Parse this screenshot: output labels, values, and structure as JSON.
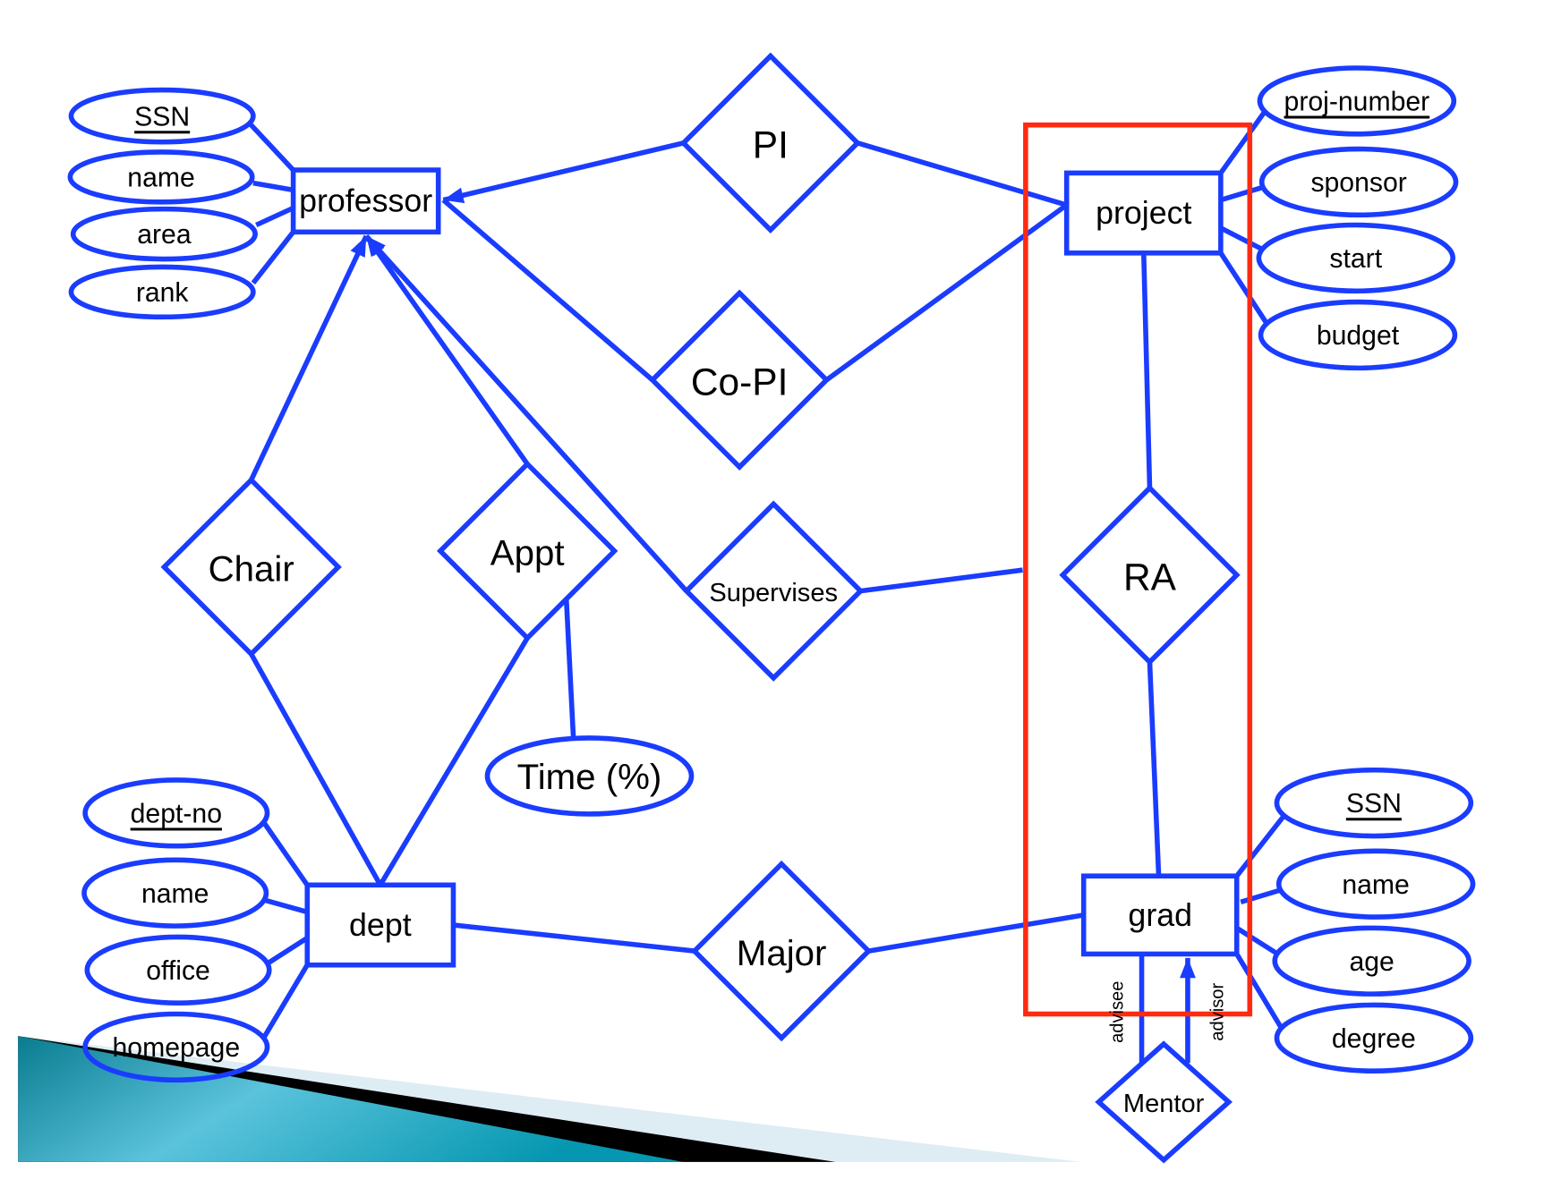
{
  "colors": {
    "shape": "#1a3cff",
    "highlight": "#ff2a10",
    "text": "#000000"
  },
  "entities": {
    "professor": "professor",
    "project": "project",
    "dept": "dept",
    "grad": "grad"
  },
  "relationships": {
    "pi": "PI",
    "copi": "Co-PI",
    "chair": "Chair",
    "appt": "Appt",
    "supervises": "Supervises",
    "ra": "RA",
    "major": "Major",
    "mentor": "Mentor"
  },
  "attributes": {
    "professor": [
      {
        "label": "SSN",
        "key": true
      },
      {
        "label": "name",
        "key": false
      },
      {
        "label": "area",
        "key": false
      },
      {
        "label": "rank",
        "key": false
      }
    ],
    "project": [
      {
        "label": "proj-number",
        "key": true
      },
      {
        "label": "sponsor",
        "key": false
      },
      {
        "label": "start",
        "key": false
      },
      {
        "label": "budget",
        "key": false
      }
    ],
    "appt": [
      {
        "label": "Time (%)",
        "key": false
      }
    ],
    "dept": [
      {
        "label": "dept-no",
        "key": true
      },
      {
        "label": "name",
        "key": false
      },
      {
        "label": "office",
        "key": false
      },
      {
        "label": "homepage",
        "key": false
      }
    ],
    "grad": [
      {
        "label": "SSN",
        "key": true
      },
      {
        "label": "name",
        "key": false
      },
      {
        "label": "age",
        "key": false
      },
      {
        "label": "degree",
        "key": false
      }
    ]
  },
  "roles": {
    "advisee": "advisee",
    "advisor": "advisor"
  }
}
